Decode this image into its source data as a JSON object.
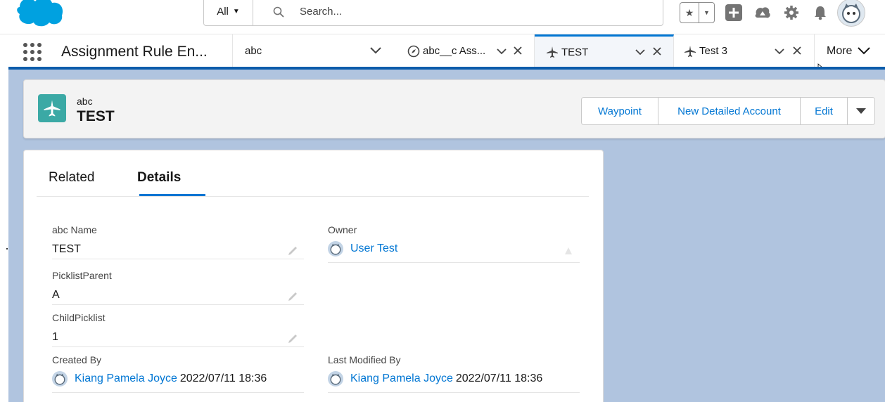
{
  "header": {
    "search_scope": "All",
    "search_placeholder": "Search..."
  },
  "nav": {
    "app_name": "Assignment Rule En...",
    "nav_item": "abc",
    "tabs": [
      {
        "label": "abc__c Ass...",
        "icon": "compass-icon",
        "active": false
      },
      {
        "label": "TEST",
        "icon": "plane-icon",
        "active": true
      },
      {
        "label": "Test 3",
        "icon": "plane-icon",
        "active": false
      }
    ],
    "more_label": "More"
  },
  "record": {
    "object_label": "abc",
    "title": "TEST",
    "actions": [
      "Waypoint",
      "New Detailed Account",
      "Edit"
    ]
  },
  "detail_tabs": [
    "Related",
    "Details"
  ],
  "fields": {
    "name_label": "abc Name",
    "name_value": "TEST",
    "owner_label": "Owner",
    "owner_value": "User Test",
    "picklist_parent_label": "PicklistParent",
    "picklist_parent_value": "A",
    "child_picklist_label": "ChildPicklist",
    "child_picklist_value": "1",
    "created_by_label": "Created By",
    "created_by_user": "Kiang Pamela Joyce",
    "created_by_date": "2022/07/11 18:36",
    "modified_by_label": "Last Modified By",
    "modified_by_user": "Kiang Pamela Joyce",
    "modified_by_date": "2022/07/11 18:36"
  },
  "colors": {
    "brand": "#0176d3",
    "record_icon": "#3ba9a5",
    "background": "#b0c4df"
  }
}
